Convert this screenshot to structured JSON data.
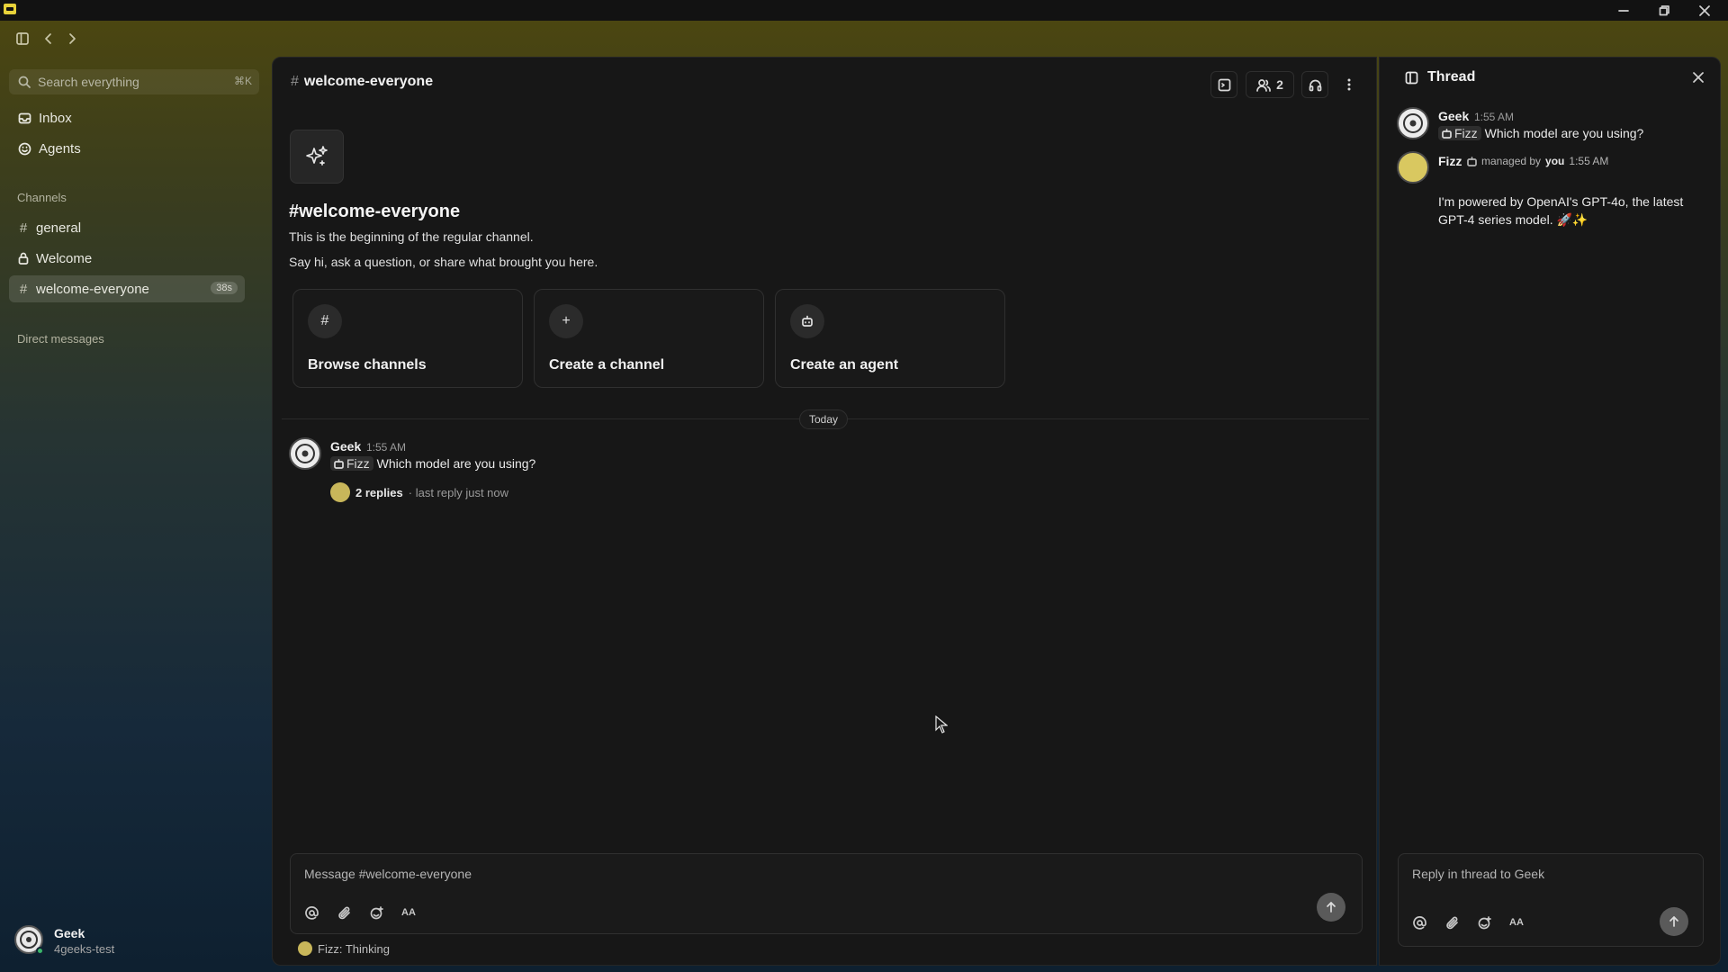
{
  "sidebar": {
    "search_placeholder": "Search everything",
    "search_shortcut": "⌘K",
    "nav": [
      {
        "label": "Inbox",
        "icon": "inbox-icon"
      },
      {
        "label": "Agents",
        "icon": "smile-icon"
      }
    ],
    "channels_label": "Channels",
    "channels": [
      {
        "label": "general",
        "icon": "hash-icon"
      },
      {
        "label": "Welcome",
        "icon": "lock-icon"
      },
      {
        "label": "welcome-everyone",
        "icon": "hash-icon",
        "badge": "38s",
        "active": true
      }
    ],
    "dm_label": "Direct messages",
    "user": {
      "name": "Geek",
      "workspace": "4geeks-test"
    }
  },
  "channel": {
    "name": "welcome-everyone",
    "member_count": "2",
    "hero_title": "#welcome-everyone",
    "hero_line1": "This is the beginning of the regular channel.",
    "hero_line2": "Say hi, ask a question, or share what brought you here.",
    "cards": [
      {
        "label": "Browse channels",
        "icon": "hash-icon"
      },
      {
        "label": "Create a channel",
        "icon": "plus-icon"
      },
      {
        "label": "Create an agent",
        "icon": "bot-icon"
      }
    ],
    "date_divider": "Today",
    "message": {
      "author": "Geek",
      "time": "1:55 AM",
      "mention": "Fizz",
      "text": "Which model are you using?",
      "replies": "2 replies",
      "last_reply": "· last reply just now"
    },
    "composer_placeholder": "Message #welcome-everyone",
    "composer_format": "AA",
    "typing": "Fizz: Thinking"
  },
  "thread": {
    "title": "Thread",
    "parent": {
      "author": "Geek",
      "time": "1:55 AM",
      "mention": "Fizz",
      "text": "Which model are you using?"
    },
    "reply": {
      "author": "Fizz",
      "managed_prefix": "managed by",
      "managed_by": "you",
      "time": "1:55 AM",
      "text": "I'm powered by OpenAI's GPT-4o, the latest GPT-4 series model. 🚀✨"
    },
    "composer_placeholder": "Reply in thread to Geek",
    "composer_format": "AA"
  }
}
